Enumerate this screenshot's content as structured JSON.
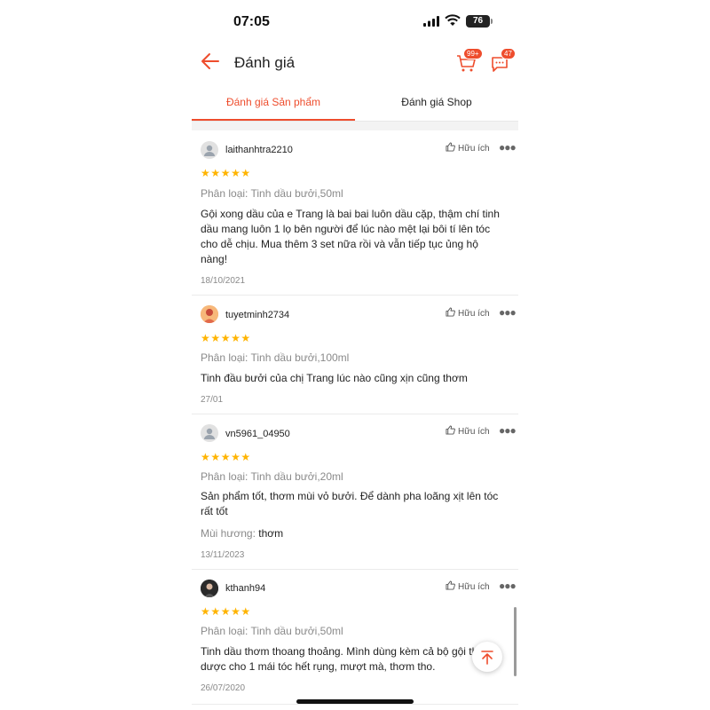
{
  "status": {
    "time": "07:05",
    "battery": "76"
  },
  "header": {
    "title": "Đánh giá",
    "cart_badge": "99+",
    "chat_badge": "47"
  },
  "tabs": [
    {
      "label": "Đánh giá Sản phẩm",
      "active": true
    },
    {
      "label": "Đánh giá Shop",
      "active": false
    }
  ],
  "colors": {
    "accent": "#ee4d2d",
    "star": "#ffb400"
  },
  "reviews": [
    {
      "username": "laithanhtra2210",
      "helpful": "Hữu ích",
      "stars": "★★★★★",
      "variant": "Phân loại: Tinh dầu bưởi,50ml",
      "text": "Gội xong dầu của e Trang là bai bai luôn dầu cặp, thậm chí tinh dầu mang luôn 1 lọ bên người để lúc nào mệt lại bôi tí lên tóc cho dễ chịu. Mua thêm 3 set nữa rồi và vẫn tiếp tục ủng hộ nàng!",
      "date": "18/10/2021"
    },
    {
      "username": "tuyetminh2734",
      "helpful": "Hữu ích",
      "stars": "★★★★★",
      "variant": "Phân loại: Tinh dầu bưởi,100ml",
      "text": "Tinh đầu bưởi của chị Trang lúc nào cũng xịn cũng thơm",
      "date": "27/01"
    },
    {
      "username": "vn5961_04950",
      "helpful": "Hữu ích",
      "stars": "★★★★★",
      "variant": "Phân loại: Tinh dầu bưởi,20ml",
      "text": "Sản phẩm tốt, thơm mùi vỏ bưởi. Để dành pha loãng xịt lên tóc rất tốt",
      "extra_label": "Mùi hương:",
      "extra_value": "thơm",
      "date": "13/11/2023"
    },
    {
      "username": "kthanh94",
      "helpful": "Hữu ích",
      "stars": "★★★★★",
      "variant": "Phân loại: Tinh dầu bưởi,50ml",
      "text": "Tinh dầu thơm thoang thoảng. Mình dùng kèm cả bộ gội thảo dược cho 1 mái tóc hết rụng, mượt mà, thơm tho.",
      "date": "26/07/2020"
    }
  ]
}
